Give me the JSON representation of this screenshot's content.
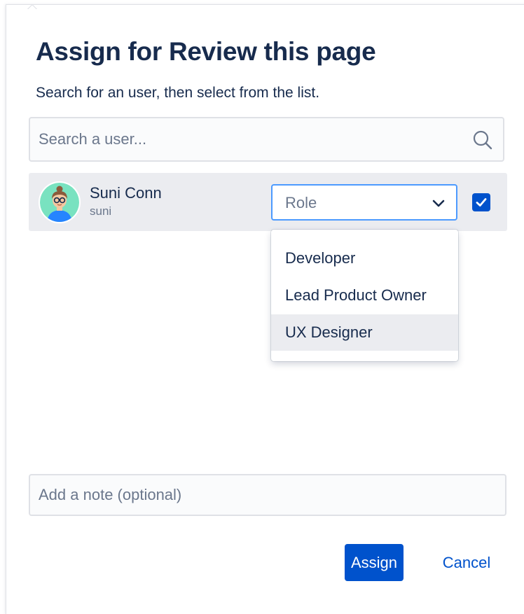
{
  "dialog": {
    "title": "Assign for Review this page",
    "subtitle": "Search for an user, then select from the list."
  },
  "search": {
    "placeholder": "Search a user...",
    "value": "",
    "icon": "search-icon"
  },
  "user": {
    "name": "Suni Conn",
    "handle": "suni",
    "avatar_icon": "avatar-illustration",
    "selected": true
  },
  "role_select": {
    "placeholder": "Role",
    "icon": "chevron-down-icon",
    "options": [
      "Developer",
      "Lead Product Owner",
      "UX Designer"
    ],
    "highlighted_option": "UX Designer"
  },
  "note": {
    "placeholder": "Add a note (optional)",
    "value": ""
  },
  "actions": {
    "assign_label": "Assign",
    "cancel_label": "Cancel"
  },
  "colors": {
    "primary": "#0052cc",
    "focus_ring": "#4c9aff",
    "row_background": "#ebecf0",
    "text": "#172b4d",
    "muted_text": "#6b778c"
  }
}
